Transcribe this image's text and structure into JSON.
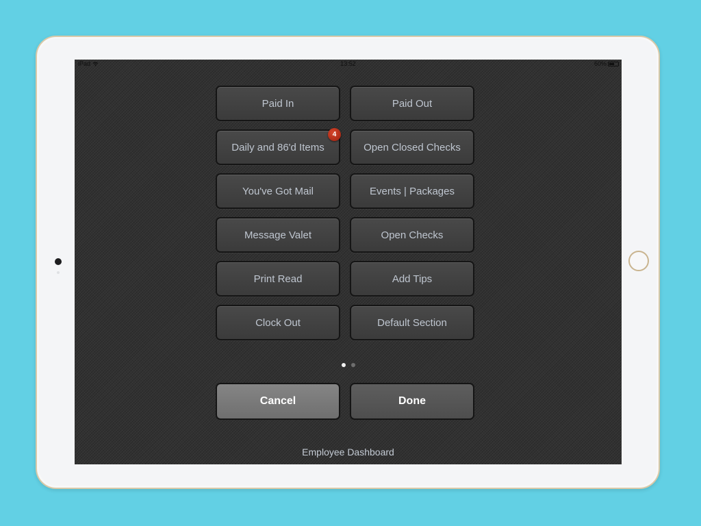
{
  "status_bar": {
    "carrier": "iPad",
    "time": "13:52",
    "battery_percent": "60%",
    "battery_level": 0.6,
    "wifi_icon": "wifi-icon",
    "battery_icon": "battery-icon"
  },
  "menu": {
    "items": [
      {
        "label": "Paid In"
      },
      {
        "label": "Paid Out"
      },
      {
        "label": "Daily and 86'd Items",
        "badge": "4"
      },
      {
        "label": "Open Closed Checks"
      },
      {
        "label": "You've Got Mail"
      },
      {
        "label": "Events | Packages"
      },
      {
        "label": "Message Valet"
      },
      {
        "label": "Open Checks"
      },
      {
        "label": "Print Read"
      },
      {
        "label": "Add Tips"
      },
      {
        "label": "Clock Out"
      },
      {
        "label": "Default Section"
      }
    ]
  },
  "pager": {
    "total_pages": 2,
    "current_page": 1
  },
  "actions": {
    "cancel_label": "Cancel",
    "done_label": "Done"
  },
  "footer": {
    "title": "Employee Dashboard"
  },
  "colors": {
    "background": "#62d0e4",
    "screen": "#323232",
    "tile_text": "#bfc6d0",
    "badge": "#c0331c",
    "cancel_button": "#7b7b7b",
    "done_button": "#565656"
  }
}
